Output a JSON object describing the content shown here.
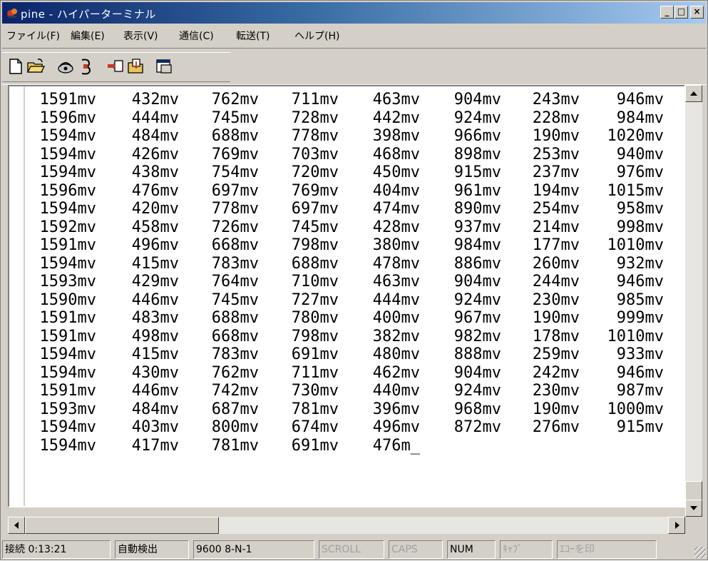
{
  "window": {
    "title": "pine - ハイパーターミナル",
    "controls": {
      "minimize": "_",
      "maximize": "□",
      "close": "×"
    }
  },
  "menu": [
    "ファイル(F)",
    "編集(E)",
    "表示(V)",
    "通信(C)",
    "転送(T)",
    "ヘルプ(H)"
  ],
  "toolbar": {
    "icons": [
      "new-icon",
      "open-icon",
      "connect-icon",
      "disconnect-icon",
      "send-icon",
      "receive-icon",
      "properties-icon"
    ]
  },
  "terminal": {
    "rows": [
      [
        "1591mv",
        "432mv",
        "762mv",
        "711mv",
        "463mv",
        "904mv",
        "243mv",
        "946mv"
      ],
      [
        "1596mv",
        "444mv",
        "745mv",
        "728mv",
        "442mv",
        "924mv",
        "228mv",
        "984mv"
      ],
      [
        "1594mv",
        "484mv",
        "688mv",
        "778mv",
        "398mv",
        "966mv",
        "190mv",
        "1020mv"
      ],
      [
        "1594mv",
        "426mv",
        "769mv",
        "703mv",
        "468mv",
        "898mv",
        "253mv",
        "940mv"
      ],
      [
        "1594mv",
        "438mv",
        "754mv",
        "720mv",
        "450mv",
        "915mv",
        "237mv",
        "976mv"
      ],
      [
        "1596mv",
        "476mv",
        "697mv",
        "769mv",
        "404mv",
        "961mv",
        "194mv",
        "1015mv"
      ],
      [
        "1594mv",
        "420mv",
        "778mv",
        "697mv",
        "474mv",
        "890mv",
        "254mv",
        "958mv"
      ],
      [
        "1592mv",
        "458mv",
        "726mv",
        "745mv",
        "428mv",
        "937mv",
        "214mv",
        "998mv"
      ],
      [
        "1591mv",
        "496mv",
        "668mv",
        "798mv",
        "380mv",
        "984mv",
        "177mv",
        "1010mv"
      ],
      [
        "1594mv",
        "415mv",
        "783mv",
        "688mv",
        "478mv",
        "886mv",
        "260mv",
        "932mv"
      ],
      [
        "1593mv",
        "429mv",
        "764mv",
        "710mv",
        "463mv",
        "904mv",
        "244mv",
        "946mv"
      ],
      [
        "1590mv",
        "446mv",
        "745mv",
        "727mv",
        "444mv",
        "924mv",
        "230mv",
        "985mv"
      ],
      [
        "1591mv",
        "483mv",
        "688mv",
        "780mv",
        "400mv",
        "967mv",
        "190mv",
        "999mv"
      ],
      [
        "1591mv",
        "498mv",
        "668mv",
        "798mv",
        "382mv",
        "982mv",
        "178mv",
        "1010mv"
      ],
      [
        "1594mv",
        "415mv",
        "783mv",
        "691mv",
        "480mv",
        "888mv",
        "259mv",
        "933mv"
      ],
      [
        "1594mv",
        "430mv",
        "762mv",
        "711mv",
        "462mv",
        "904mv",
        "242mv",
        "946mv"
      ],
      [
        "1591mv",
        "446mv",
        "742mv",
        "730mv",
        "440mv",
        "924mv",
        "230mv",
        "987mv"
      ],
      [
        "1593mv",
        "484mv",
        "687mv",
        "781mv",
        "396mv",
        "968mv",
        "190mv",
        "1000mv"
      ],
      [
        "1594mv",
        "403mv",
        "800mv",
        "674mv",
        "496mv",
        "872mv",
        "276mv",
        "915mv"
      ],
      [
        "1594mv",
        "417mv",
        "781mv",
        "691mv",
        "476m_",
        "",
        "",
        ""
      ]
    ]
  },
  "statusbar": {
    "connection": "接続 0:13:21",
    "detect": "自動検出",
    "settings": "9600 8-N-1",
    "scroll": "SCROLL",
    "caps": "CAPS",
    "num": "NUM",
    "capture": "ｷｬﾌﾟ",
    "echo": "ｴｺｰを印"
  }
}
